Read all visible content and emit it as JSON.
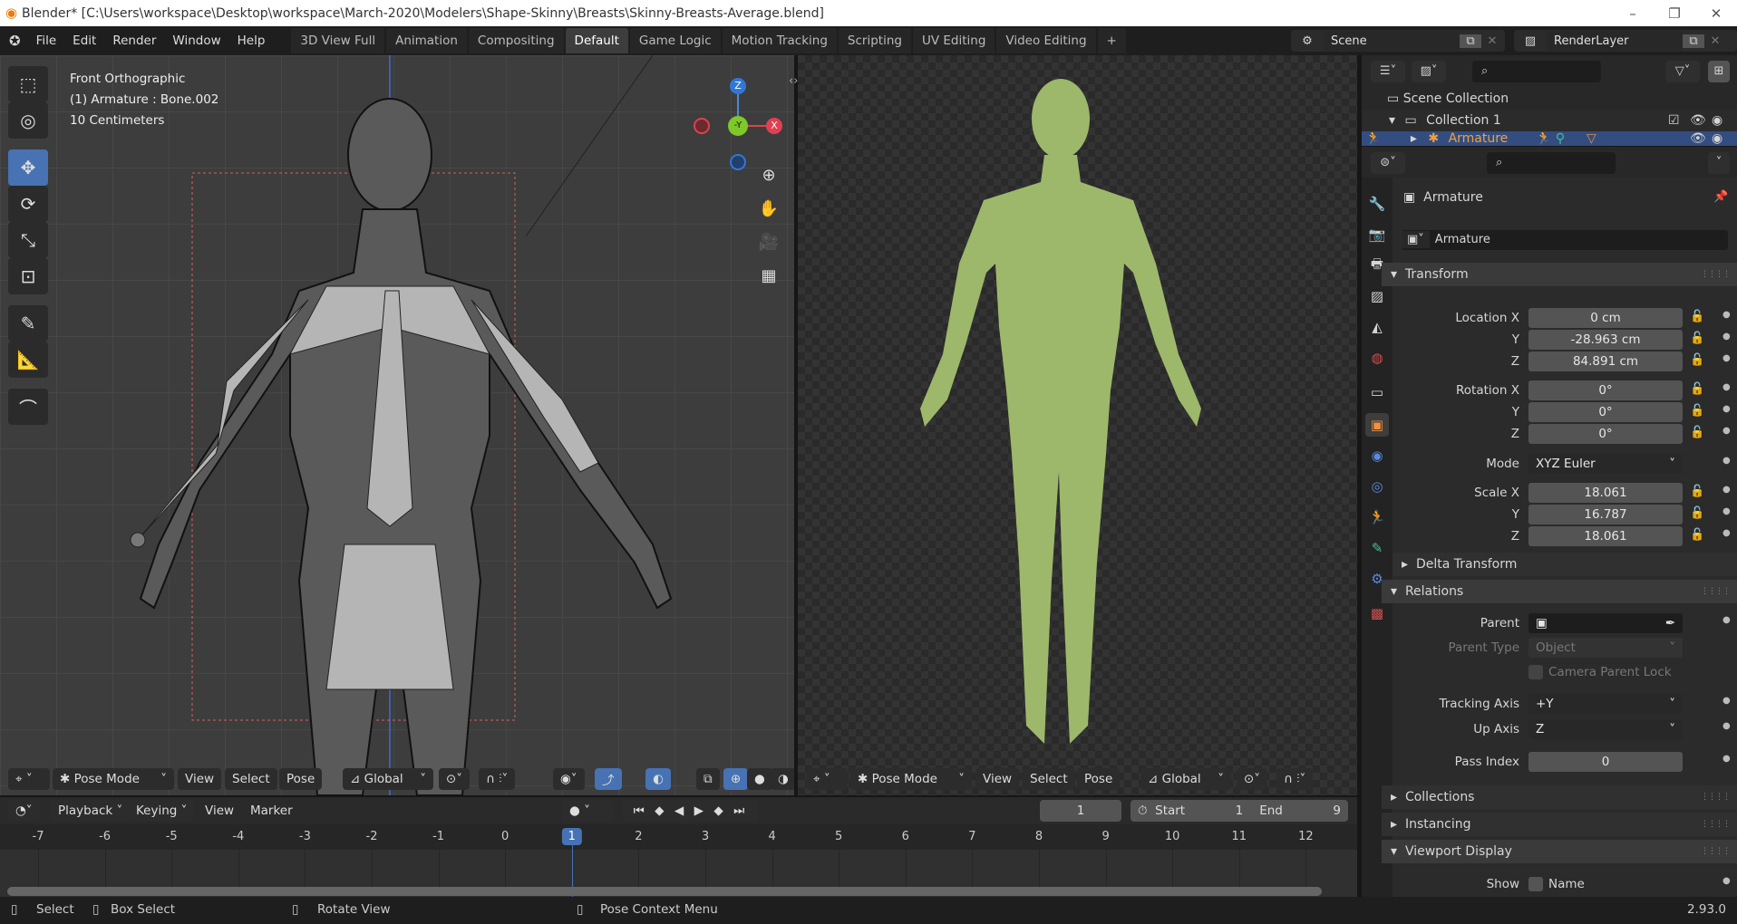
{
  "window": {
    "title": "Blender* [C:\\Users\\workspace\\Desktop\\workspace\\March-2020\\Modelers\\Shape-Skinny\\Breasts\\Skinny-Breasts-Average.blend]",
    "minimize": "–",
    "maximize": "❐",
    "close": "✕"
  },
  "menus": [
    "File",
    "Edit",
    "Render",
    "Window",
    "Help"
  ],
  "workspaces": [
    "3D View Full",
    "Animation",
    "Compositing",
    "Default",
    "Game Logic",
    "Motion Tracking",
    "Scripting",
    "UV Editing",
    "Video Editing"
  ],
  "active_workspace": "Default",
  "add_workspace": "+",
  "scene": "Scene",
  "render_layer": "RenderLayer",
  "viewport_left": {
    "view": "Front Orthographic",
    "object": "(1) Armature : Bone.002",
    "scale": "10 Centimeters",
    "gizmo": {
      "z": "Z",
      "y": "-Y",
      "x": "X"
    },
    "header": {
      "mode": "Pose Mode",
      "view": "View",
      "select": "Select",
      "pose": "Pose",
      "orientation": "Global"
    }
  },
  "viewport_right": {
    "header": {
      "mode": "Pose Mode",
      "view": "View",
      "select": "Select",
      "pose": "Pose",
      "orientation": "Global"
    }
  },
  "outliner": {
    "scene_collection": "Scene Collection",
    "collection": "Collection 1",
    "armature": "Armature"
  },
  "properties": {
    "object_name": "Armature",
    "name_field": "Armature",
    "transform": "Transform",
    "location_x_label": "Location X",
    "location": [
      "0 cm",
      "-28.963 cm",
      "84.891 cm"
    ],
    "rotation_x_label": "Rotation X",
    "rotation": [
      "0°",
      "0°",
      "0°"
    ],
    "y_label": "Y",
    "z_label": "Z",
    "mode_label": "Mode",
    "mode": "XYZ Euler",
    "scale_x_label": "Scale X",
    "scale": [
      "18.061",
      "16.787",
      "18.061"
    ],
    "delta": "Delta Transform",
    "relations": "Relations",
    "parent_label": "Parent",
    "parent_type_label": "Parent Type",
    "parent_type": "Object",
    "camera_parent_lock": "Camera Parent Lock",
    "tracking_axis_label": "Tracking Axis",
    "tracking_axis": "+Y",
    "up_axis_label": "Up Axis",
    "up_axis": "Z",
    "pass_index_label": "Pass Index",
    "pass_index": "0",
    "collections": "Collections",
    "instancing": "Instancing",
    "viewport_display": "Viewport Display",
    "show_label": "Show",
    "name_check": "Name"
  },
  "timeline": {
    "playback": "Playback",
    "keying": "Keying",
    "view": "View",
    "marker": "Marker",
    "current_frame": "1",
    "start_label": "Start",
    "start": "1",
    "end_label": "End",
    "end": "9",
    "ticks": [
      "-7",
      "-6",
      "-5",
      "-4",
      "-3",
      "-2",
      "-1",
      "0",
      "1",
      "2",
      "3",
      "4",
      "5",
      "6",
      "7",
      "8",
      "9",
      "10",
      "11",
      "12"
    ]
  },
  "status": {
    "select": "Select",
    "box_select": "Box Select",
    "rotate_view": "Rotate View",
    "context_menu": "Pose Context Menu",
    "version": "2.93.0"
  },
  "colors": {
    "accent": "#4772b3",
    "active_object": "#f0a040",
    "armature_green": "#3fc0a0"
  }
}
